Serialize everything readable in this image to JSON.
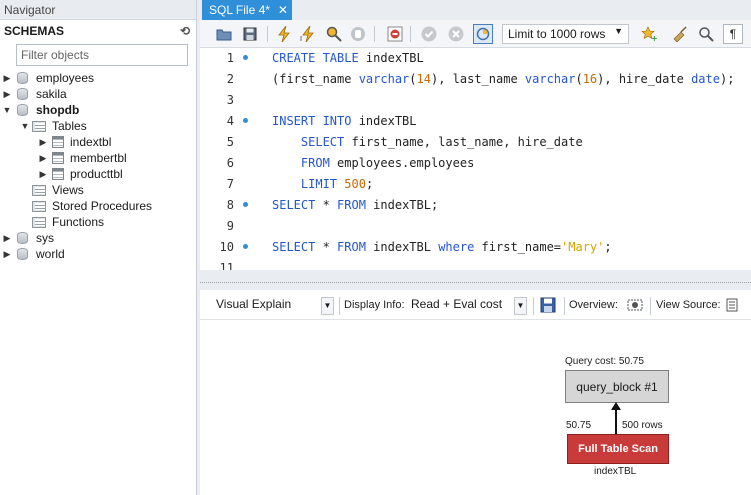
{
  "navigator": {
    "title": "Navigator",
    "schemas_label": "SCHEMAS",
    "filter_placeholder": "Filter objects",
    "schemas": [
      {
        "name": "employees",
        "expanded": false
      },
      {
        "name": "sakila",
        "expanded": false
      },
      {
        "name": "shopdb",
        "expanded": true
      },
      {
        "name": "sys",
        "expanded": false
      },
      {
        "name": "world",
        "expanded": false
      }
    ],
    "shopdb": {
      "tables_label": "Tables",
      "tables": [
        "indextbl",
        "membertbl",
        "producttbl"
      ],
      "views_label": "Views",
      "procedures_label": "Stored Procedures",
      "functions_label": "Functions"
    }
  },
  "editor": {
    "tab_title": "SQL File 4*",
    "limit_label": "Limit to 1000 rows",
    "lines": [
      {
        "n": "1",
        "dot": true
      },
      {
        "n": "2",
        "dot": false
      },
      {
        "n": "3",
        "dot": false
      },
      {
        "n": "4",
        "dot": true
      },
      {
        "n": "5",
        "dot": false
      },
      {
        "n": "6",
        "dot": false
      },
      {
        "n": "7",
        "dot": false
      },
      {
        "n": "8",
        "dot": true
      },
      {
        "n": "9",
        "dot": false
      },
      {
        "n": "10",
        "dot": true
      },
      {
        "n": "11",
        "dot": false
      }
    ]
  },
  "explain": {
    "mode": "Visual Explain",
    "display_info_label": "Display Info:",
    "display_info_value": "Read + Eval cost",
    "overview_label": "Overview:",
    "view_source_label": "View Source:",
    "query_cost": "Query cost: 50.75",
    "query_block": "query_block #1",
    "edge_cost": "50.75",
    "edge_rows": "500 rows",
    "scan_label": "Full Table Scan",
    "scan_table": "indexTBL"
  },
  "colors": {
    "accent": "#2f8fd8",
    "scan": "#c93b3b",
    "keyword": "#2457c9"
  }
}
